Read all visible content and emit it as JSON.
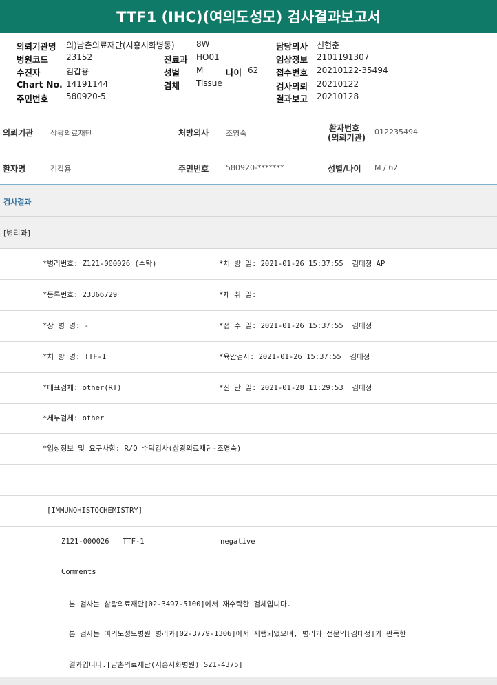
{
  "title": "TTF1 (IHC)(여의도성모) 검사결과보고서",
  "header": {
    "req_org_label": "의뢰기관명",
    "req_org": "의)남촌의료재단(시흥시화병동)",
    "ward": "8W",
    "doctor_label": "담당의사",
    "doctor": "신현춘",
    "hosp_code_label": "병원코드",
    "hosp_code": "23152",
    "dept_label": "진료과",
    "dept": "HO01",
    "clin_info_label": "임상정보",
    "clin_info": "2101191307",
    "patient_label": "수진자",
    "patient": "김갑용",
    "sex_label": "성별",
    "sex": "M",
    "age_label": "나이",
    "age": "62",
    "receipt_label": "접수번호",
    "receipt": "20210122-35494",
    "chart_label": "Chart No.",
    "chart": "14191144",
    "specimen_label": "검체",
    "specimen": "Tissue",
    "test_req_label": "검사의뢰",
    "test_req": "20210122",
    "rrn_label": "주민번호",
    "rrn": "580920-5",
    "report_label": "결과보고",
    "report": "20210128"
  },
  "patient_info": {
    "org_label": "의뢰기관",
    "org": "삼광의료재단",
    "doc_label": "처방의사",
    "doc": "조영숙",
    "pid_label_1": "환자번호",
    "pid_label_2": "(의뢰기관)",
    "pid": "012235494",
    "name_label": "환자명",
    "name": "김갑용",
    "rrn_label": "주민번호",
    "rrn": "580920-*******",
    "sexage_label": "성별/나이",
    "sexage": "M / 62"
  },
  "result_section": "검사결과",
  "dept_section": "[병리과]",
  "report_lines": [
    {
      "left": "*병리번호: Z121-000026 (수탁)",
      "right": "*처 방 일: 2021-01-26 15:37:55  김태정 AP"
    },
    {
      "left": "*등록번호: 23366729",
      "right": "*채 취 일:"
    },
    {
      "left": "*상 병 명: -",
      "right": "*접 수 일: 2021-01-26 15:37:55  김태정"
    },
    {
      "left": "*처 방 명: TTF-1",
      "right": "*육안검사: 2021-01-26 15:37:55  김태정"
    },
    {
      "left": "*대표검체: other(RT)",
      "right": "*진 단 일: 2021-01-28 11:29:53  김태정"
    },
    {
      "left": "*세부검체: other",
      "right": ""
    },
    {
      "left": "*임상정보 및 요구사항: R/O 수탁검사(삼광의료재단-조영숙)",
      "right": ""
    }
  ],
  "ihc_header": "[IMMUNOHISTOCHEMISTRY]",
  "ihc_result": {
    "case": "Z121-000026",
    "marker": "TTF-1",
    "result": "negative"
  },
  "comments_label": "Comments",
  "comment_lines": [
    "본 검사는 삼광의료재단[02-3497-5100]에서 재수탁한 검체입니다.",
    "본 검사는 여의도성모병원 병리과[02-3779-1306]에서 시행되었으며, 병리과 전문의[김태정]가 판독한",
    "결과입니다.[남촌의료재단(시흥시화병원) S21-4375]"
  ]
}
